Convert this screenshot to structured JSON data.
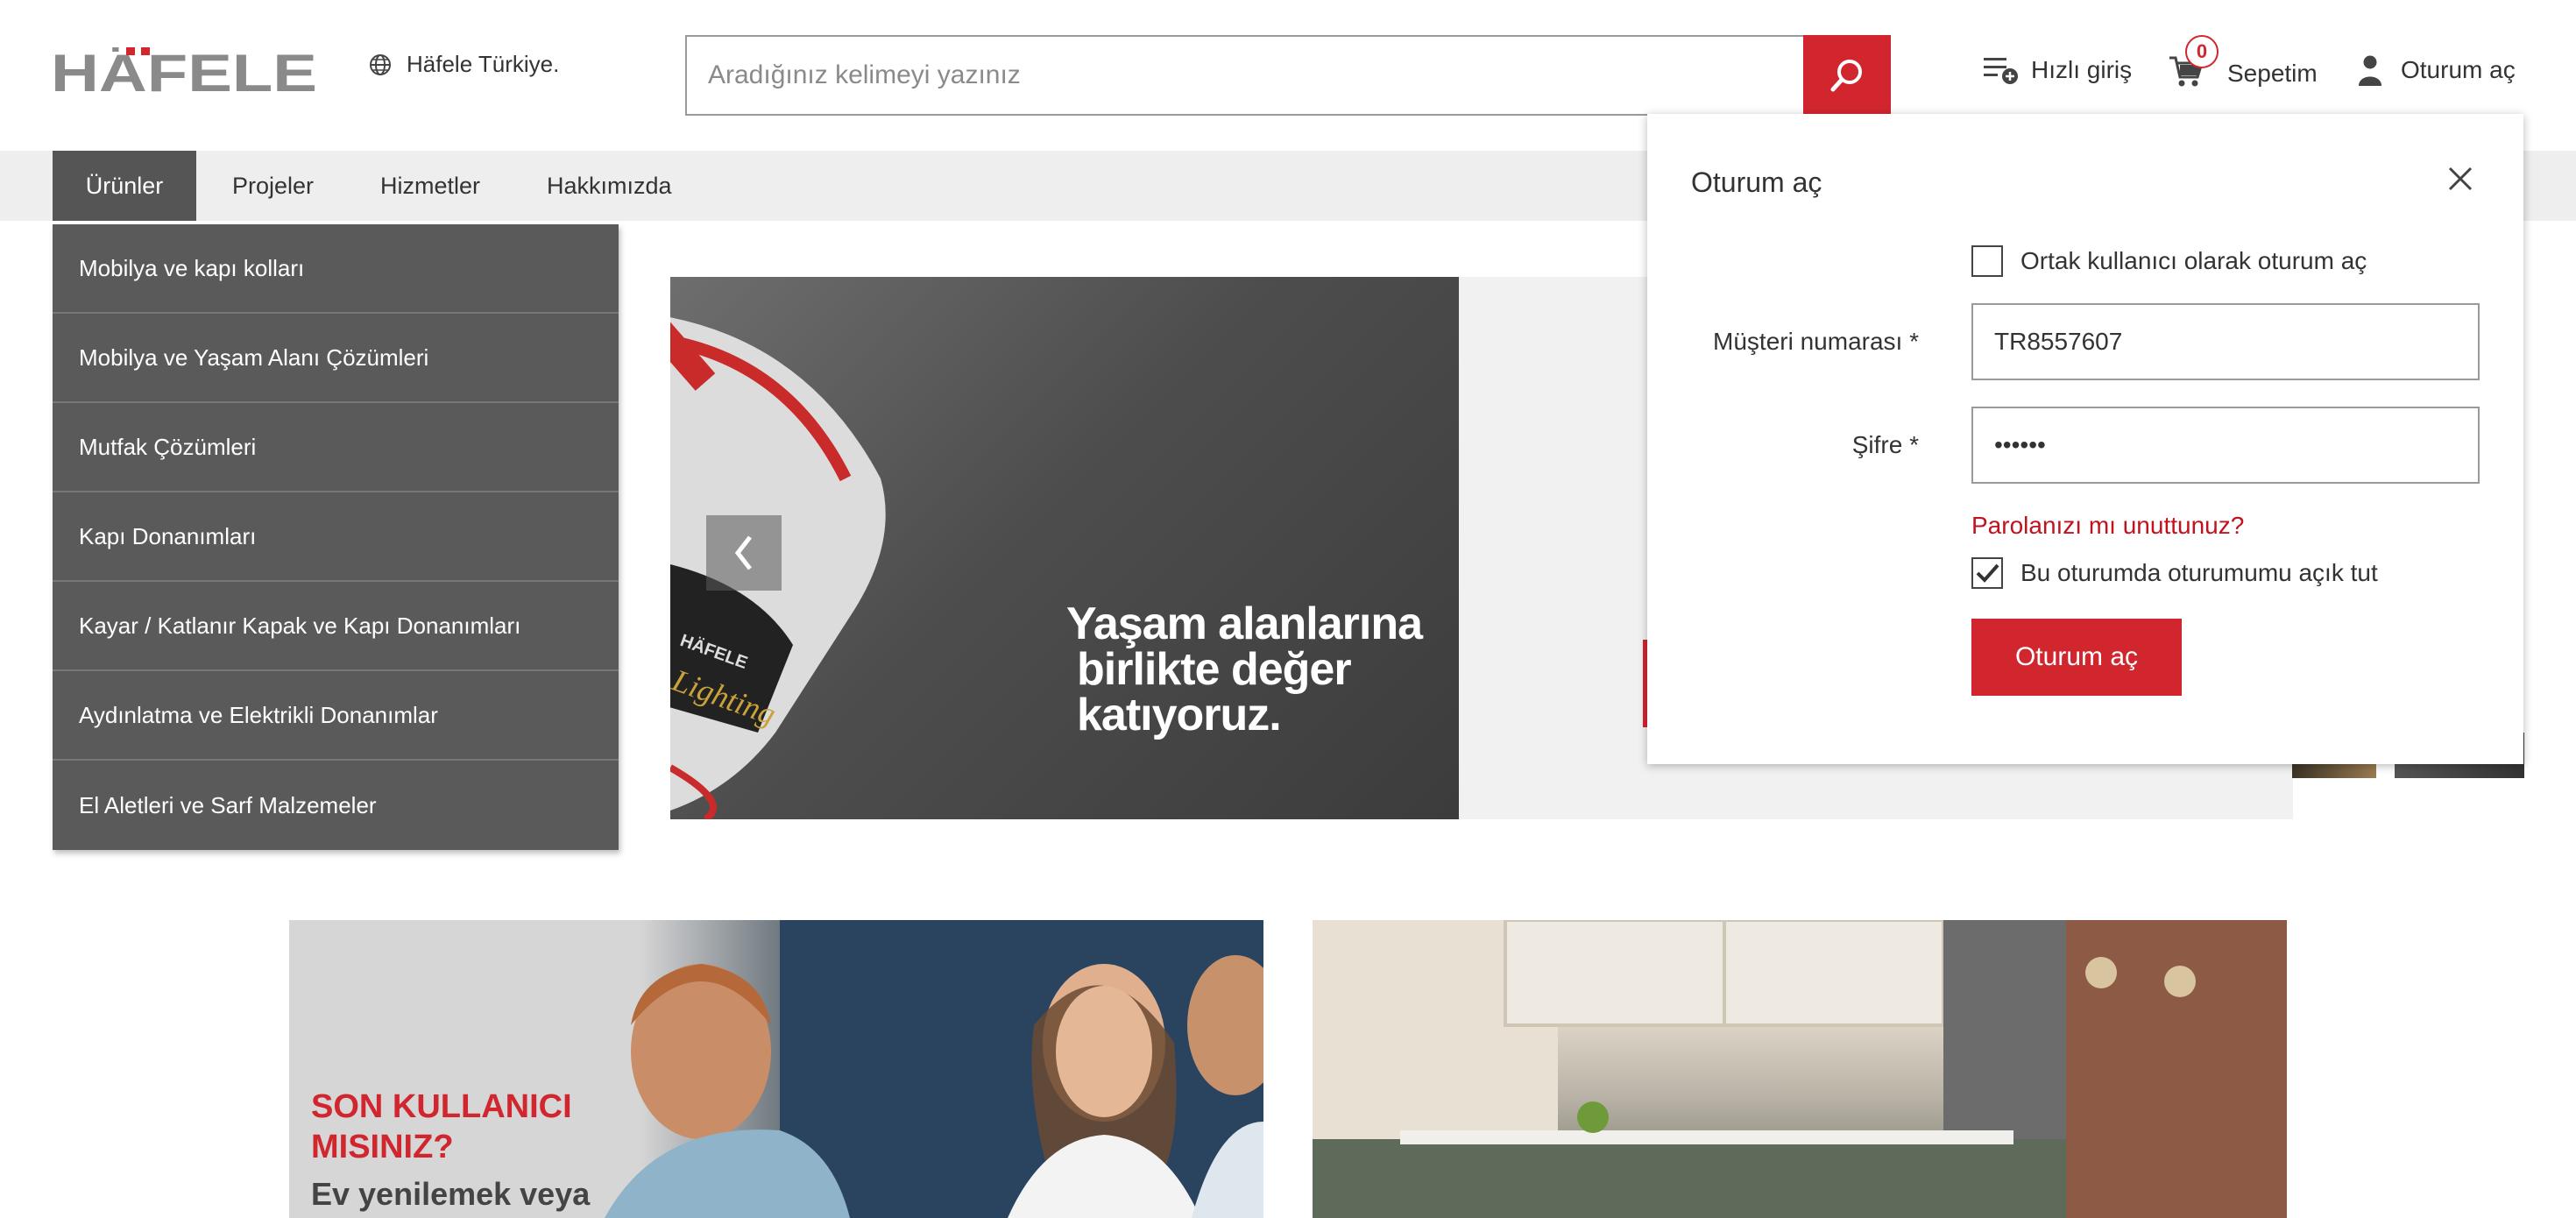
{
  "header": {
    "logo_text": "HÄFELE",
    "locale": "Häfele Türkiye.",
    "search_placeholder": "Aradığınız kelimeyi yazınız",
    "quick_login": "Hızlı giriş",
    "cart_label": "Sepetim",
    "cart_count": "0",
    "signin_label": "Oturum aç"
  },
  "nav": {
    "items": [
      "Ürünler",
      "Projeler",
      "Hizmetler",
      "Hakkımızda"
    ],
    "active": "Ürünler"
  },
  "product_menu": [
    "Mobilya ve kapı kolları",
    "Mobilya ve Yaşam Alanı Çözümleri",
    "Mutfak Çözümleri",
    "Kapı Donanımları",
    "Kayar / Katlanır Kapak ve Kapı Donanımları",
    "Aydınlatma ve Elektrikli Donanımlar",
    "El Aletleri ve Sarf Malzemeler"
  ],
  "hero": {
    "line1": "Yaşam alanlarına",
    "line2": "birlikte değer",
    "line3": "katıyoruz.",
    "brand_small": "HÄFELE",
    "lighting": "Lighting"
  },
  "promo": {
    "title": "SON KULLANICI MISINIZ?",
    "subtitle": "Ev yenilemek veya"
  },
  "login": {
    "title": "Oturum aç",
    "shared_user_label": "Ortak kullanıcı olarak oturum aç",
    "shared_user_checked": false,
    "customer_number_label": "Müşteri numarası *",
    "customer_number_value": "TR8557607",
    "password_label": "Şifre *",
    "password_value": "••••••",
    "forgot_link": "Parolanızı mı unuttunuz?",
    "keep_signed_in_label": "Bu oturumda oturumumu açık tut",
    "keep_signed_in_checked": true,
    "submit_label": "Oturum aç"
  },
  "colors": {
    "brand_red": "#d2262f",
    "menu_bg": "#5a5a5a",
    "nav_bg": "#eeeeee"
  }
}
